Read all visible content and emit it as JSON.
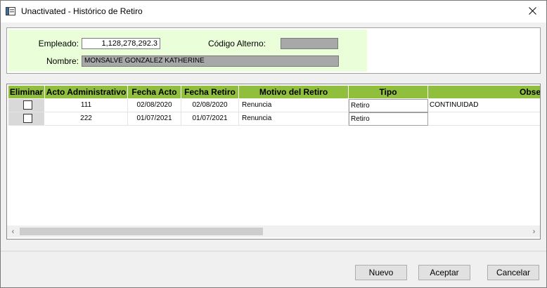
{
  "window": {
    "title": "Unactivated - Histórico de Retiro"
  },
  "form": {
    "empleado_label": "Empleado:",
    "empleado_value": "1,128,278,292.3",
    "codigo_label": "Código Alterno:",
    "codigo_value": "",
    "nombre_label": "Nombre:",
    "nombre_value": "MONSALVE GONZALEZ KATHERINE"
  },
  "grid": {
    "columns": [
      "Eliminar",
      "Acto Administrativo",
      "Fecha Acto",
      "Fecha Retiro",
      "Motivo del Retiro",
      "Tipo",
      "Obse"
    ],
    "rows": [
      {
        "acto": "111",
        "fecha_acto": "02/08/2020",
        "fecha_retiro": "02/08/2020",
        "motivo": "Renuncia",
        "tipo": "Retiro",
        "obs": "CONTINUIDAD"
      },
      {
        "acto": "222",
        "fecha_acto": "01/07/2021",
        "fecha_retiro": "01/07/2021",
        "motivo": "Renuncia",
        "tipo": "Retiro",
        "obs": ""
      }
    ]
  },
  "buttons": {
    "nuevo": "Nuevo",
    "aceptar": "Aceptar",
    "cancelar": "Cancelar"
  },
  "colors": {
    "header_green": "#8fbf3c",
    "panel_green": "#eaffd9"
  }
}
